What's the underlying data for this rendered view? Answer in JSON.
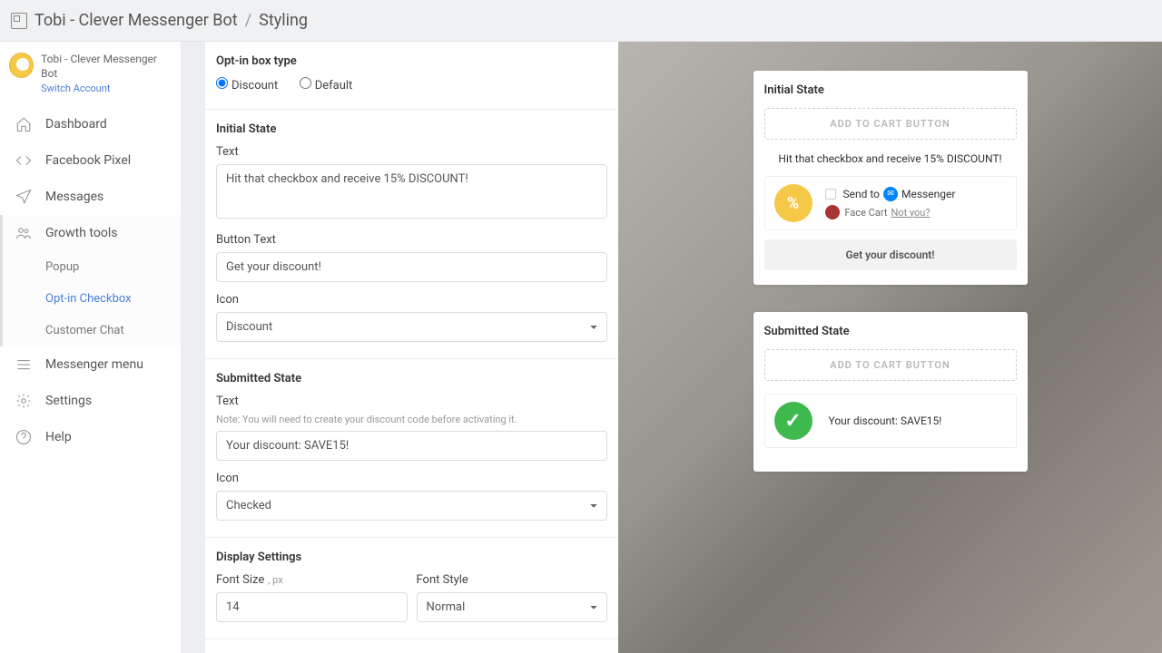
{
  "breadcrumb": {
    "app": "Tobi - Clever Messenger Bot",
    "page": "Styling"
  },
  "sidebar": {
    "account_name": "Tobi - Clever Messenger Bot",
    "switch_link": "Switch Account",
    "items": [
      {
        "label": "Dashboard"
      },
      {
        "label": "Facebook Pixel"
      },
      {
        "label": "Messages"
      },
      {
        "label": "Growth tools",
        "sub": [
          {
            "label": "Popup"
          },
          {
            "label": "Opt-in Checkbox",
            "active": true
          },
          {
            "label": "Customer Chat"
          }
        ]
      },
      {
        "label": "Messenger menu"
      },
      {
        "label": "Settings"
      },
      {
        "label": "Help"
      }
    ]
  },
  "form": {
    "opt_in_box": {
      "title": "Opt-in box type",
      "options": [
        {
          "label": "Discount",
          "checked": true
        },
        {
          "label": "Default",
          "checked": false
        }
      ]
    },
    "initial_state": {
      "title": "Initial State",
      "text_label": "Text",
      "text_value": "Hit that checkbox and receive 15% DISCOUNT!",
      "button_text_label": "Button Text",
      "button_text_value": "Get your discount!",
      "icon_label": "Icon",
      "icon_value": "Discount"
    },
    "submitted_state": {
      "title": "Submitted State",
      "text_label": "Text",
      "note": "Note: You will need to create your discount code before activating it.",
      "text_value": "Your discount: SAVE15!",
      "icon_label": "Icon",
      "icon_value": "Checked"
    },
    "display_settings": {
      "title": "Display Settings",
      "font_size_label": "Font Size",
      "font_size_suffix": ", px",
      "font_size_value": "14",
      "font_style_label": "Font Style",
      "font_style_value": "Normal"
    }
  },
  "preview": {
    "initial": {
      "title": "Initial State",
      "atc": "ADD TO CART BUTTON",
      "text": "Hit that checkbox and receive 15% DISCOUNT!",
      "send_to": "Send to",
      "messenger": "Messenger",
      "face_cart": "Face Cart",
      "not_you": "Not you?",
      "btn": "Get your discount!"
    },
    "submitted": {
      "title": "Submitted State",
      "atc": "ADD TO CART BUTTON",
      "text": "Your discount: SAVE15!"
    }
  }
}
